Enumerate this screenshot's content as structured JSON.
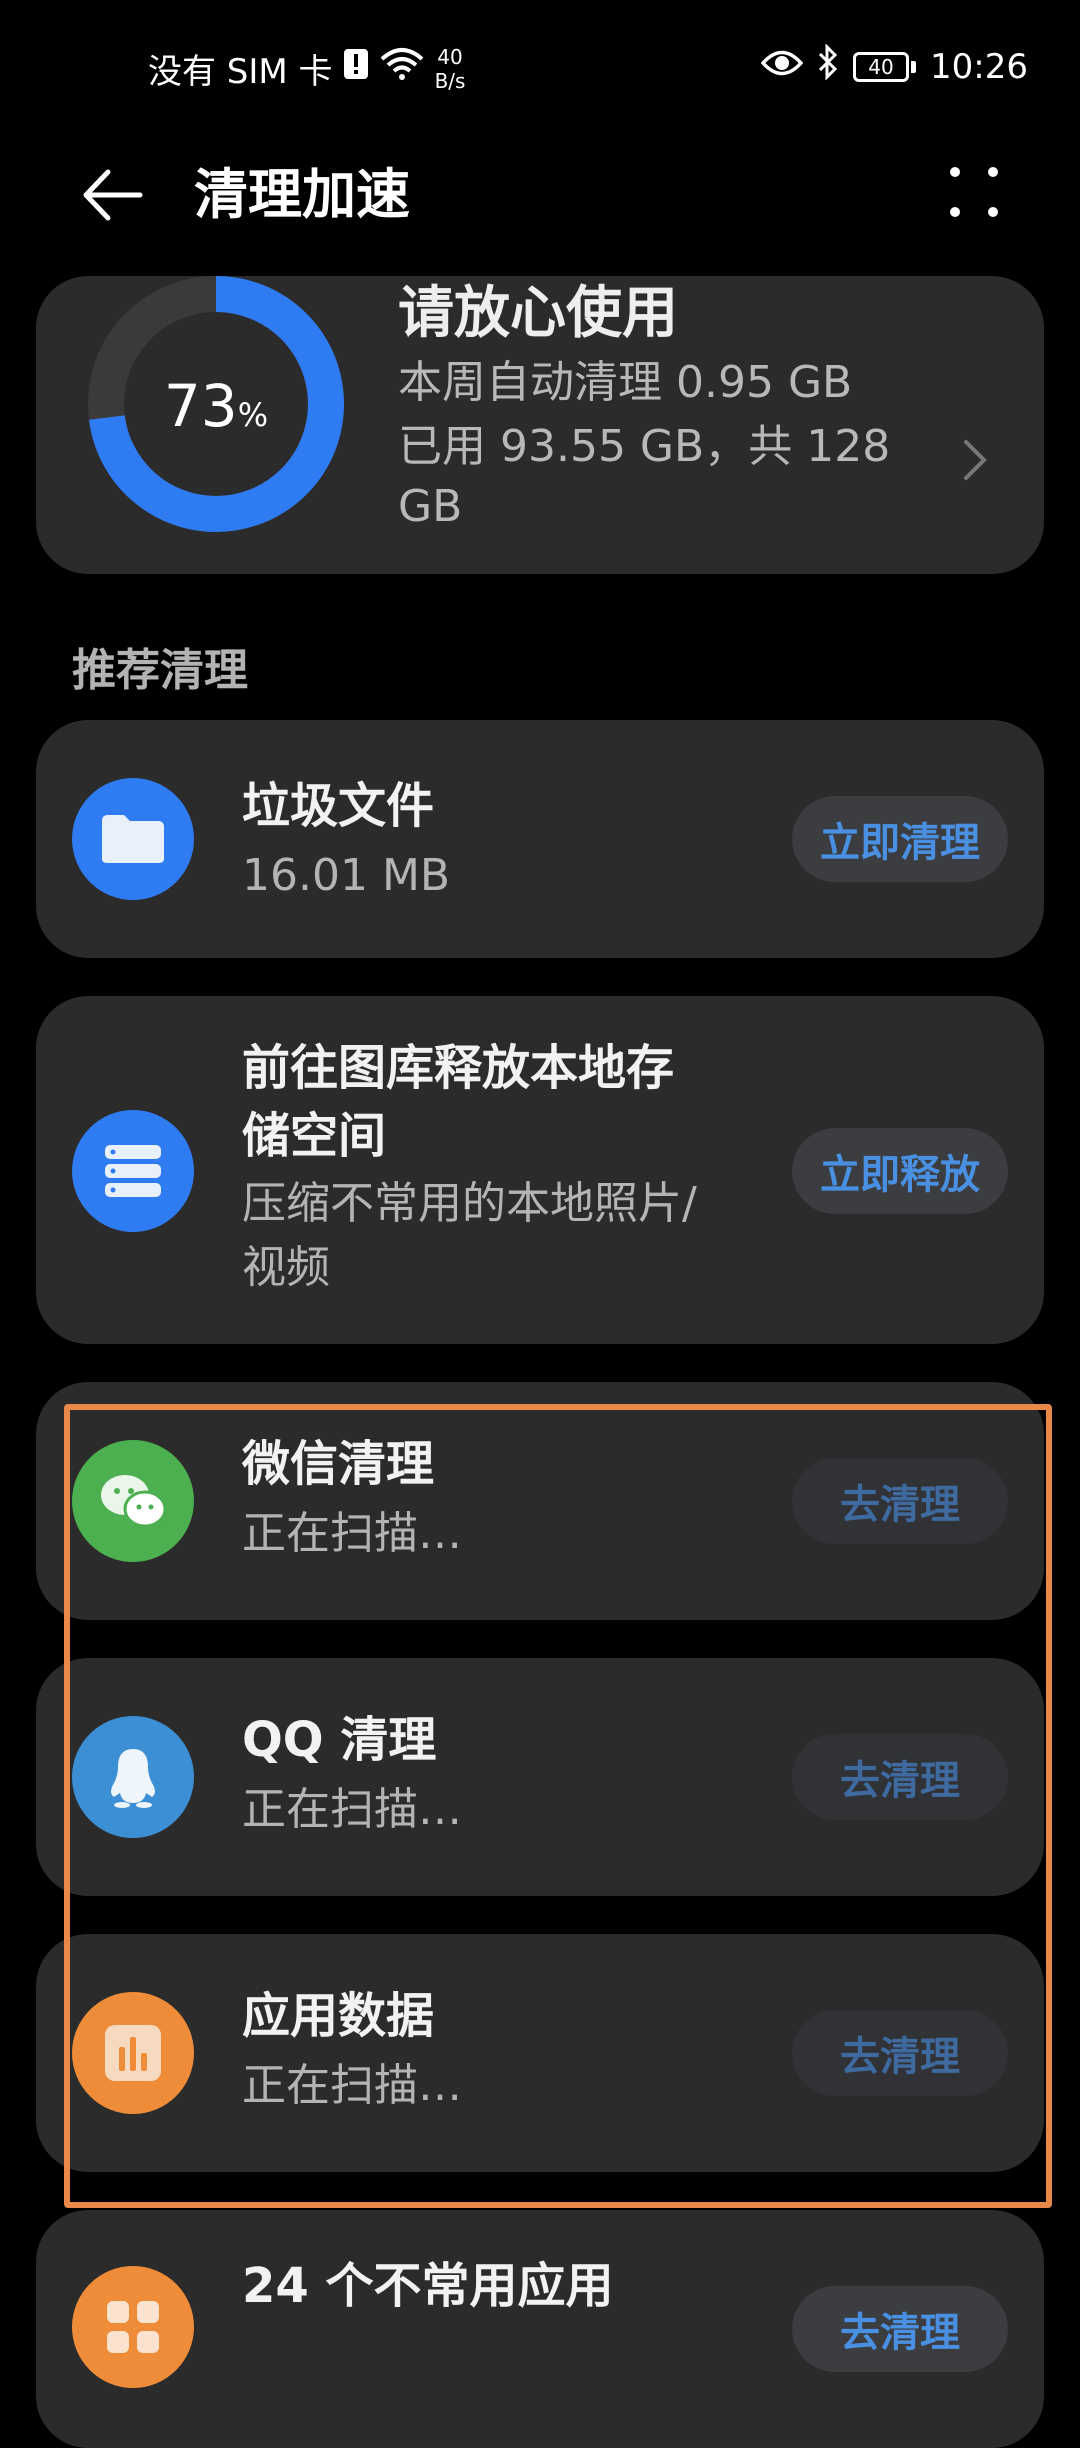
{
  "status_bar": {
    "carrier": "没有 SIM 卡",
    "net_speed_value": "40",
    "net_speed_unit": "B/s",
    "battery": "40",
    "time": "10:26"
  },
  "app_bar": {
    "title": "清理加速"
  },
  "storage": {
    "title": "请放心使用",
    "percent": "73",
    "percent_unit": "%",
    "percent_fraction": 0.73,
    "line1": "本周自动清理 0.95 GB",
    "line2": "已用 93.55 GB，共 128",
    "line3": "GB"
  },
  "section": {
    "label": "推荐清理"
  },
  "items": [
    {
      "title1": "垃圾文件",
      "title2": "",
      "sub1": "16.01 MB",
      "sub2": "",
      "button": "立即清理",
      "color": "#2f7bf2"
    },
    {
      "title1": "前往图库释放本地存",
      "title2": "储空间",
      "sub1": "压缩不常用的本地照片/",
      "sub2": "视频",
      "button": "立即释放",
      "color": "#2f7bf2"
    },
    {
      "title1": "微信清理",
      "title2": "",
      "sub1": "正在扫描…",
      "sub2": "",
      "button": "去清理",
      "color": "#4caf50"
    },
    {
      "title1": "QQ 清理",
      "title2": "",
      "sub1": "正在扫描…",
      "sub2": "",
      "button": "去清理",
      "color": "#3c8fd4"
    },
    {
      "title1": "应用数据",
      "title2": "",
      "sub1": "正在扫描…",
      "sub2": "",
      "button": "去清理",
      "color": "#ef8c3a"
    },
    {
      "title1": "24 个不常用应用",
      "title2": "",
      "sub1": "",
      "sub2": "",
      "button": "去清理",
      "color": "#ef8c3a"
    }
  ]
}
